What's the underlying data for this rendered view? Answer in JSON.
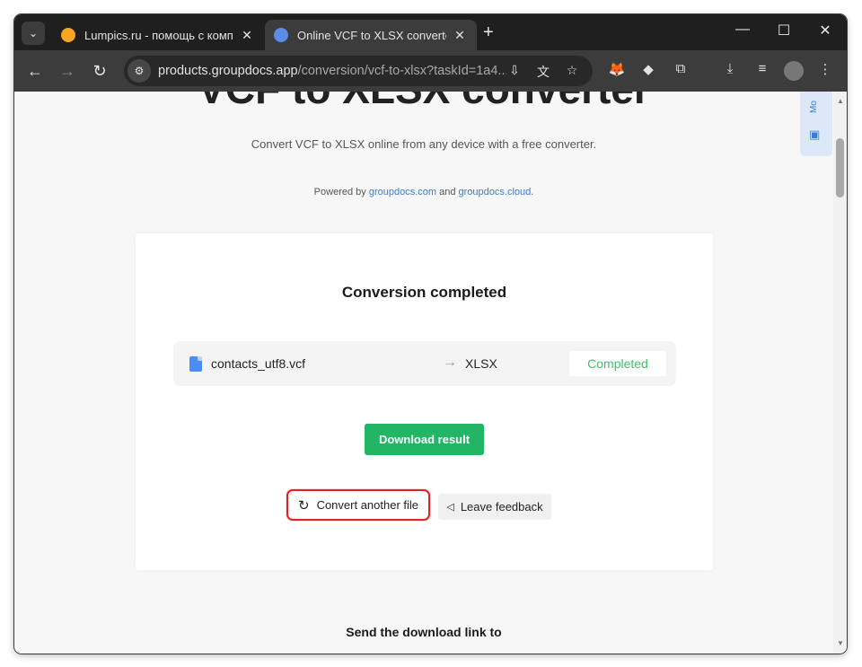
{
  "browser": {
    "tabs": [
      {
        "title": "Lumpics.ru - помощь с компью",
        "active": false,
        "favicon_color": "#f5a623"
      },
      {
        "title": "Online VCF to XLSX converter | G",
        "active": true,
        "favicon_color": "#5a8de6"
      }
    ],
    "url_host": "products.groupdocs.app",
    "url_path": "/conversion/vcf-to-xlsx?taskId=1a4..."
  },
  "page": {
    "hero_title": "VCF to XLSX converter",
    "subtitle": "Convert VCF to XLSX online from any device with a free converter.",
    "powered_prefix": "Powered by",
    "powered_link1": "groupdocs.com",
    "powered_and": "and",
    "powered_link2": "groupdocs.cloud",
    "card": {
      "title": "Conversion completed",
      "file_name": "contacts_utf8.vcf",
      "arrow": "→",
      "target_format": "XLSX",
      "status": "Completed",
      "download_label": "Download result",
      "convert_another_label": "Convert another file",
      "feedback_label": "Leave feedback"
    },
    "send_title": "Send the download link to",
    "side_widget_text": "Mo"
  },
  "colors": {
    "accent_green": "#22b566",
    "status_green": "#3fbf6e",
    "link_blue": "#3a7bd5",
    "highlight_red": "#e02424"
  }
}
